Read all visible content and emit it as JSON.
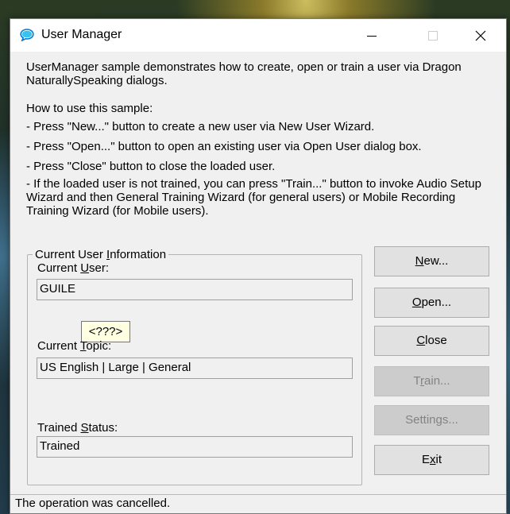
{
  "window": {
    "title": "User Manager",
    "description": "UserManager sample demonstrates how to create, open or train a user via Dragon NaturallySpeaking dialogs.",
    "howto": {
      "heading": "How to use this sample:",
      "lines": [
        "- Press \"New...\" button to create a new user via New User Wizard.",
        "- Press \"Open...\" button to open an existing user via Open User dialog box.",
        "- Press \"Close\" button to close the loaded user.",
        "- If the loaded user is not trained, you can press \"Train...\" button to invoke Audio Setup Wizard and then General Training Wizard (for general users) or Mobile Recording Training Wizard (for Mobile users)."
      ]
    }
  },
  "user_info": {
    "group_label": {
      "pre": "Current User ",
      "acc": "I",
      "post": "nformation"
    },
    "current_user_label": {
      "pre": "Current ",
      "acc": "U",
      "post": "ser:"
    },
    "current_user_value": "GUILE",
    "tooltip": "<???>",
    "current_topic_label": {
      "pre": "Current ",
      "acc": "T",
      "post": "opic:"
    },
    "current_topic_value": "US English | Large | General",
    "trained_status_label": {
      "pre": "Trained ",
      "acc": "S",
      "post": "tatus:"
    },
    "trained_status_value": "Trained"
  },
  "buttons": {
    "new": {
      "acc": "N",
      "post": "ew..."
    },
    "open": {
      "acc": "O",
      "post": "pen..."
    },
    "close": {
      "acc": "C",
      "post": "lose"
    },
    "train": {
      "pre": "T",
      "acc": "r",
      "post": "ain..."
    },
    "settings": {
      "pre": "Settin",
      "acc": "g",
      "post": "s..."
    },
    "exit": {
      "pre": "E",
      "acc": "x",
      "post": "it"
    }
  },
  "status_bar": {
    "text": "The operation was cancelled."
  },
  "colors": {
    "accent_icon": "#0078d7",
    "disabled_text": "#838383",
    "tooltip_bg": "#ffffe1"
  }
}
